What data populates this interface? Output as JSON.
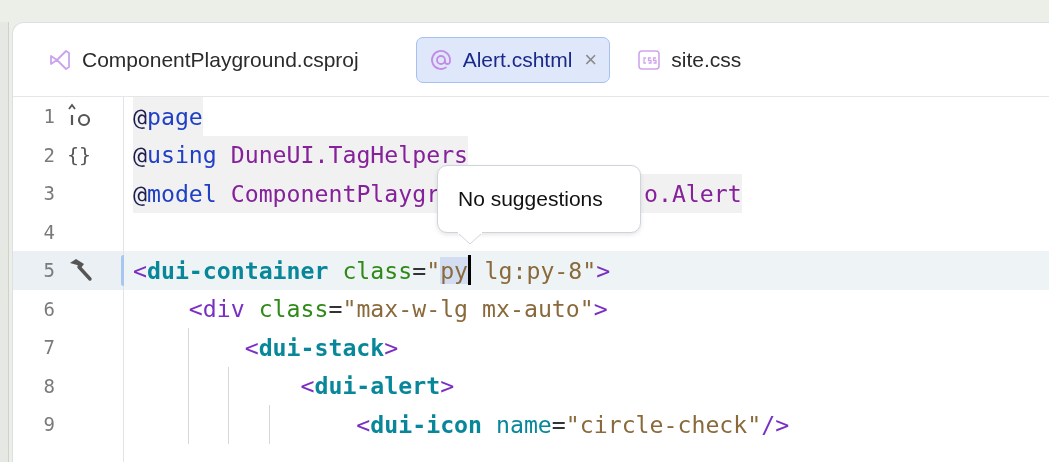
{
  "tabs": [
    {
      "label": "ComponentPlayground.csproj",
      "selected": false,
      "closable": false
    },
    {
      "label": "Alert.cshtml",
      "selected": true,
      "closable": true,
      "close": "×"
    },
    {
      "label": "site.css",
      "selected": false,
      "closable": false
    }
  ],
  "editor": {
    "lines": [
      {
        "number": "1",
        "kind": "injection",
        "block": true,
        "current": false,
        "tokens": [
          {
            "kind": "at",
            "text": "@"
          },
          {
            "kind": "keyword",
            "text": "page"
          }
        ]
      },
      {
        "number": "2",
        "kind": "braces",
        "gutter_text": "{}",
        "block": true,
        "current": false,
        "tokens": [
          {
            "kind": "at",
            "text": "@"
          },
          {
            "kind": "keyword",
            "text": "using"
          },
          {
            "kind": "type",
            "text": " DuneUI.TagHelpers"
          }
        ]
      },
      {
        "number": "3",
        "kind": "plain",
        "block": true,
        "current": false,
        "tokens": [
          {
            "kind": "at",
            "text": "@"
          },
          {
            "kind": "keyword",
            "text": "model"
          },
          {
            "kind": "type",
            "text": " ComponentPlaygr"
          },
          {
            "kind": "gap"
          },
          {
            "kind": "type",
            "text": "o.Alert"
          }
        ]
      },
      {
        "number": "4",
        "kind": "plain",
        "block": false,
        "current": false
      },
      {
        "number": "5",
        "kind": "hammer",
        "block": false,
        "current": true,
        "changed": true,
        "tokens": [
          {
            "kind": "bracket",
            "text": "<"
          },
          {
            "kind": "tag",
            "text": "dui-container"
          },
          {
            "kind": "attr",
            "text": " class"
          },
          {
            "kind": "punct",
            "text": "="
          },
          {
            "kind": "string",
            "text": "\""
          },
          {
            "kind": "string",
            "text": "py",
            "selected": true
          },
          {
            "kind": "caret"
          },
          {
            "kind": "string",
            "text": " lg:py-8\""
          },
          {
            "kind": "bracket",
            "text": ">"
          }
        ]
      },
      {
        "number": "6",
        "kind": "plain",
        "block": false,
        "current": false,
        "tokens": [
          {
            "kind": "bracket",
            "text": "    <"
          },
          {
            "kind": "tag2",
            "text": "div"
          },
          {
            "kind": "attr",
            "text": " class"
          },
          {
            "kind": "punct",
            "text": "="
          },
          {
            "kind": "string",
            "text": "\"max-w-lg mx-auto\""
          },
          {
            "kind": "bracket",
            "text": ">"
          }
        ]
      },
      {
        "number": "7",
        "kind": "plain",
        "block": false,
        "current": false,
        "tokens": [
          {
            "kind": "bracket",
            "text": "        <"
          },
          {
            "kind": "tag",
            "text": "dui-stack"
          },
          {
            "kind": "bracket",
            "text": ">"
          }
        ]
      },
      {
        "number": "8",
        "kind": "plain",
        "block": false,
        "current": false,
        "tokens": [
          {
            "kind": "bracket",
            "text": "            <"
          },
          {
            "kind": "tag",
            "text": "dui-alert"
          },
          {
            "kind": "bracket",
            "text": ">"
          }
        ]
      },
      {
        "number": "9",
        "kind": "plain",
        "block": false,
        "current": false,
        "tokens": [
          {
            "kind": "bracket",
            "text": "                <"
          },
          {
            "kind": "tag",
            "text": "dui-icon"
          },
          {
            "kind": "tagattr",
            "text": " name"
          },
          {
            "kind": "punct",
            "text": "="
          },
          {
            "kind": "string",
            "text": "\"circle-check\""
          },
          {
            "kind": "bracket",
            "text": "/>"
          }
        ]
      }
    ],
    "tooltip": {
      "text": "No suggestions"
    }
  }
}
